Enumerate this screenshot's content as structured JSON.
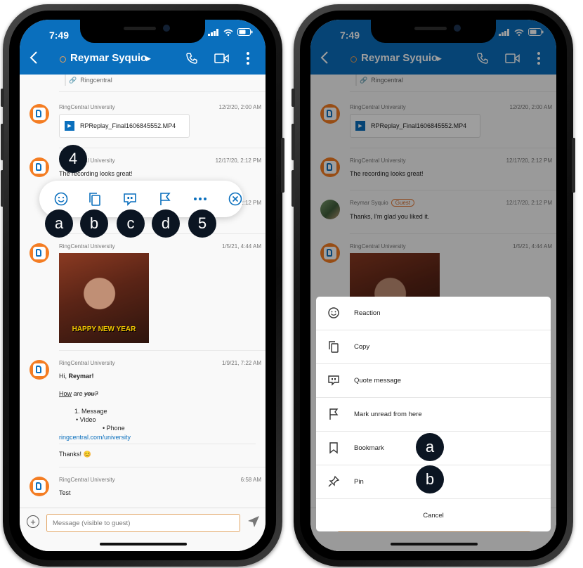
{
  "status_bar": {
    "time": "7:49"
  },
  "header": {
    "contact_name": "Reymar Syquio"
  },
  "chat": {
    "pinned_chip": "Ringcentral",
    "messages": [
      {
        "sender": "RingCentral University",
        "time": "12/2/20, 2:00 AM",
        "file_name": "RPReplay_Final1606845552.MP4"
      },
      {
        "sender": "RingCentral University",
        "time": "12/17/20, 2:12 PM",
        "text": "The recording looks great!"
      },
      {
        "sender": "Reymar Syquio",
        "guest_tag": "Guest",
        "time": "12/17/20, 2:12 PM",
        "text": "Thanks, I'm glad you liked it."
      },
      {
        "sender": "RingCentral University",
        "time": "1/5/21, 4:44 AM",
        "gif_caption": "HAPPY NEW YEAR"
      },
      {
        "sender": "RingCentral University",
        "time": "1/9/21, 7:22 AM",
        "greeting": "Hi, ",
        "greeting_name": "Reymar!",
        "question_underline": "How",
        "question_italic": " are ",
        "question_strike": "you?",
        "list_numbered": "1. Message",
        "list_bullet1": "• Video",
        "list_bullet2": "• Phone",
        "link": "ringcentral.com/university",
        "thanks": "Thanks! 😊"
      },
      {
        "sender": "RingCentral University",
        "time": "6:58 AM",
        "text": "Test"
      }
    ]
  },
  "composer": {
    "placeholder": "Message (visible to guest)"
  },
  "action_bar": {
    "icons": [
      "reaction-icon",
      "copy-icon",
      "quote-icon",
      "flag-icon",
      "more-icon",
      "close-icon"
    ]
  },
  "callouts": {
    "four": "4",
    "five": "5",
    "a": "a",
    "b": "b",
    "c": "c",
    "d": "d"
  },
  "sheet": {
    "items": [
      "Reaction",
      "Copy",
      "Quote message",
      "Mark unread from here",
      "Bookmark",
      "Pin"
    ],
    "cancel": "Cancel"
  },
  "sheet_callouts": {
    "a": "a",
    "b": "b"
  },
  "colors": {
    "header_blue": "#0a6fbd",
    "accent_orange": "#f47d23",
    "badge_dark": "#0b1522"
  }
}
